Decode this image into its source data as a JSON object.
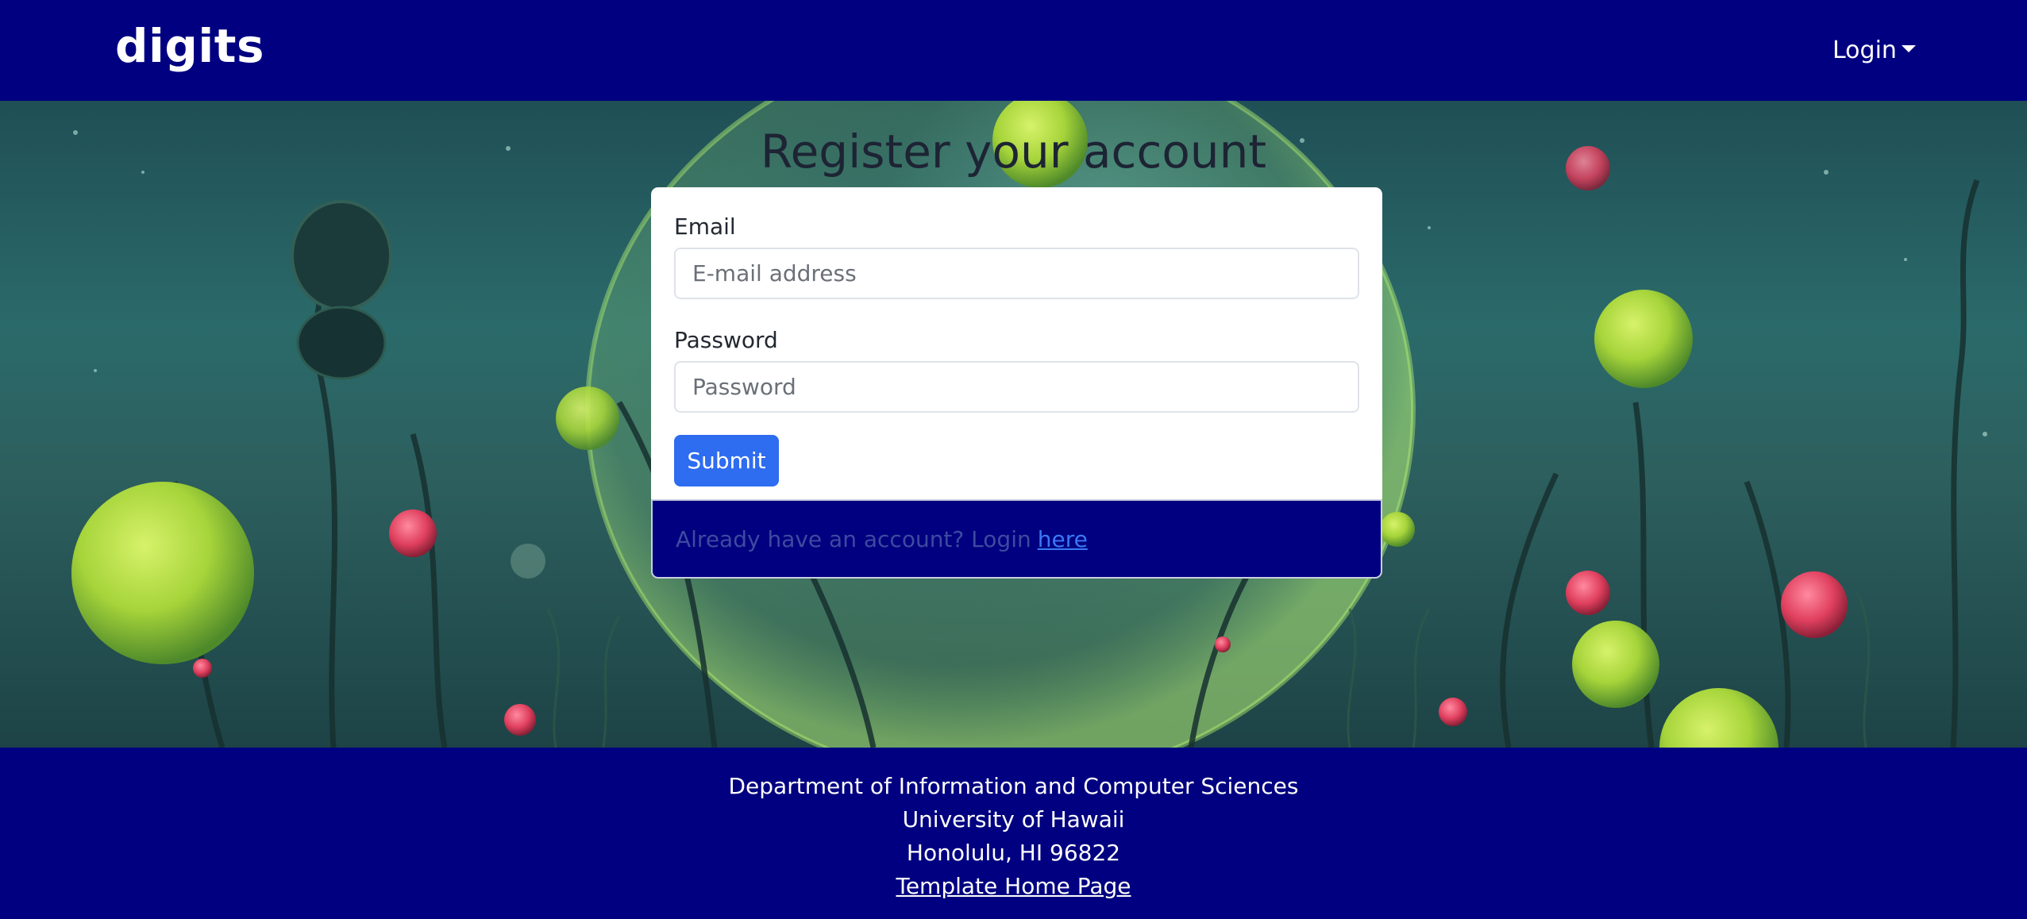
{
  "navbar": {
    "brand": "digits",
    "login_menu_label": "Login",
    "login_menu_icon": "caret-down-icon",
    "background_color": "#000080"
  },
  "hero": {
    "title": "Register your account",
    "background_image": "underwater-plants-illustration"
  },
  "form": {
    "email_label": "Email",
    "email_placeholder": "E-mail address",
    "email_value": "",
    "password_label": "Password",
    "password_placeholder": "Password",
    "password_value": "",
    "submit_label": "Submit",
    "submit_color": "#2e6cf0"
  },
  "login_prompt": {
    "text": "Already have an account? Login",
    "link_text": "here"
  },
  "footer": {
    "line1": "Department of Information and Computer Sciences",
    "line2": "University of Hawaii",
    "line3": "Honolulu, HI 96822",
    "link_text": "Template Home Page"
  }
}
